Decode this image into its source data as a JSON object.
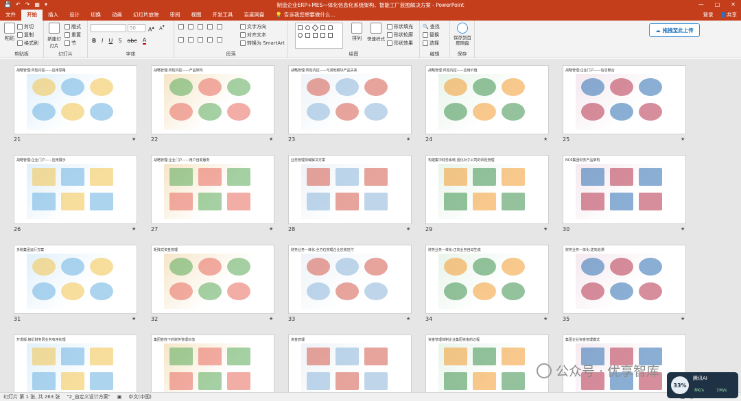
{
  "app": {
    "window_title": "制造企业ERP+MES一体化信息化系统架构、智能工厂蓝图解决方案 - PowerPoint",
    "qat": [
      "💾",
      "↶",
      "↷",
      "▦",
      "▾"
    ],
    "window_controls": [
      "—",
      "□",
      "✕"
    ]
  },
  "tabs": {
    "file": "文件",
    "items": [
      "开始",
      "插入",
      "设计",
      "切换",
      "动画",
      "幻灯片放映",
      "审阅",
      "视图",
      "开发工具",
      "百度网盘"
    ],
    "tell_me": "告诉我您想要做什么...",
    "login": "登录",
    "share": "共享"
  },
  "ribbon": {
    "clipboard": {
      "paste": "粘贴",
      "cut": "剪切",
      "copy": "复制",
      "format_painter": "格式刷",
      "label": "剪贴板"
    },
    "slides": {
      "new_slide": "新建幻灯片",
      "layout": "版式",
      "reset": "重置",
      "section": "节",
      "label": "幻灯片"
    },
    "font": {
      "label": "字体",
      "size": "50"
    },
    "paragraph": {
      "text_direction": "文字方向",
      "align_text": "对齐文本",
      "smartart": "转换为 SmartArt",
      "label": "段落"
    },
    "drawing": {
      "arrange": "排列",
      "quick_styles": "快速样式",
      "fill": "形状填充",
      "outline": "形状轮廓",
      "effects": "形状效果",
      "label": "绘图"
    },
    "editing": {
      "find": "查找",
      "replace": "替换",
      "select": "选择",
      "label": "编辑"
    },
    "save": {
      "save_to_baidu": "保存到百度网盘",
      "label": "保存"
    },
    "cloud_button": "拖拽至此上传"
  },
  "slides": [
    {
      "num": "21",
      "title": "战略管理:风险内控——应用思路",
      "star": "★"
    },
    {
      "num": "22",
      "title": "战略管理:风险内控——产品架构",
      "star": "★"
    },
    {
      "num": "23",
      "title": "战略管理:风险内控——与其他模块产品关系",
      "star": "★"
    },
    {
      "num": "24",
      "title": "战略管理:风险内控——应用价值",
      "star": "★"
    },
    {
      "num": "25",
      "title": "战略管理:企业门户——信息聚合",
      "star": "★"
    },
    {
      "num": "26",
      "title": "战略管理:企业门户——应用展示",
      "star": "★"
    },
    {
      "num": "27",
      "title": "战略管理:企业门户——用户自助服务",
      "star": "★"
    },
    {
      "num": "28",
      "title": "业务管理领域解决方案",
      "star": "★"
    },
    {
      "num": "29",
      "title": "构建集中财务系统,强化对子公司的风险管理",
      "star": "★"
    },
    {
      "num": "30",
      "title": "NC6集团财务产品架构",
      "star": "★"
    },
    {
      "num": "31",
      "title": "多账集团运行方案",
      "star": "★"
    },
    {
      "num": "32",
      "title": "矩阵式资金管理",
      "star": "★"
    },
    {
      "num": "33",
      "title": "财务业务一体化:全方位管理企业应收应付",
      "star": "★"
    },
    {
      "num": "34",
      "title": "财务业务一体化:正向业务自动生成",
      "star": "★"
    },
    {
      "num": "35",
      "title": "财务业务一体化:逆向追溯",
      "star": "★"
    },
    {
      "num": "",
      "title": "开发版:接近财务层业务有序处理",
      "star": ""
    },
    {
      "num": "",
      "title": "集团管控下的财务管理价值",
      "star": ""
    },
    {
      "num": "",
      "title": "资金管理",
      "star": ""
    },
    {
      "num": "",
      "title": "资金管理体制企业集团资金的过程",
      "star": ""
    },
    {
      "num": "",
      "title": "集团企业资金管理模式",
      "star": ""
    }
  ],
  "status": {
    "slide_info": "幻灯片 第 1 张, 共 263 张",
    "theme": "\"2_自定义设计方案\"",
    "language": "中文(中国)"
  },
  "watermark": "公众号 · 优享智库",
  "widget": {
    "percent": "33%",
    "title": "腾讯AI",
    "down": "8K/s",
    "up": "1M/s"
  }
}
